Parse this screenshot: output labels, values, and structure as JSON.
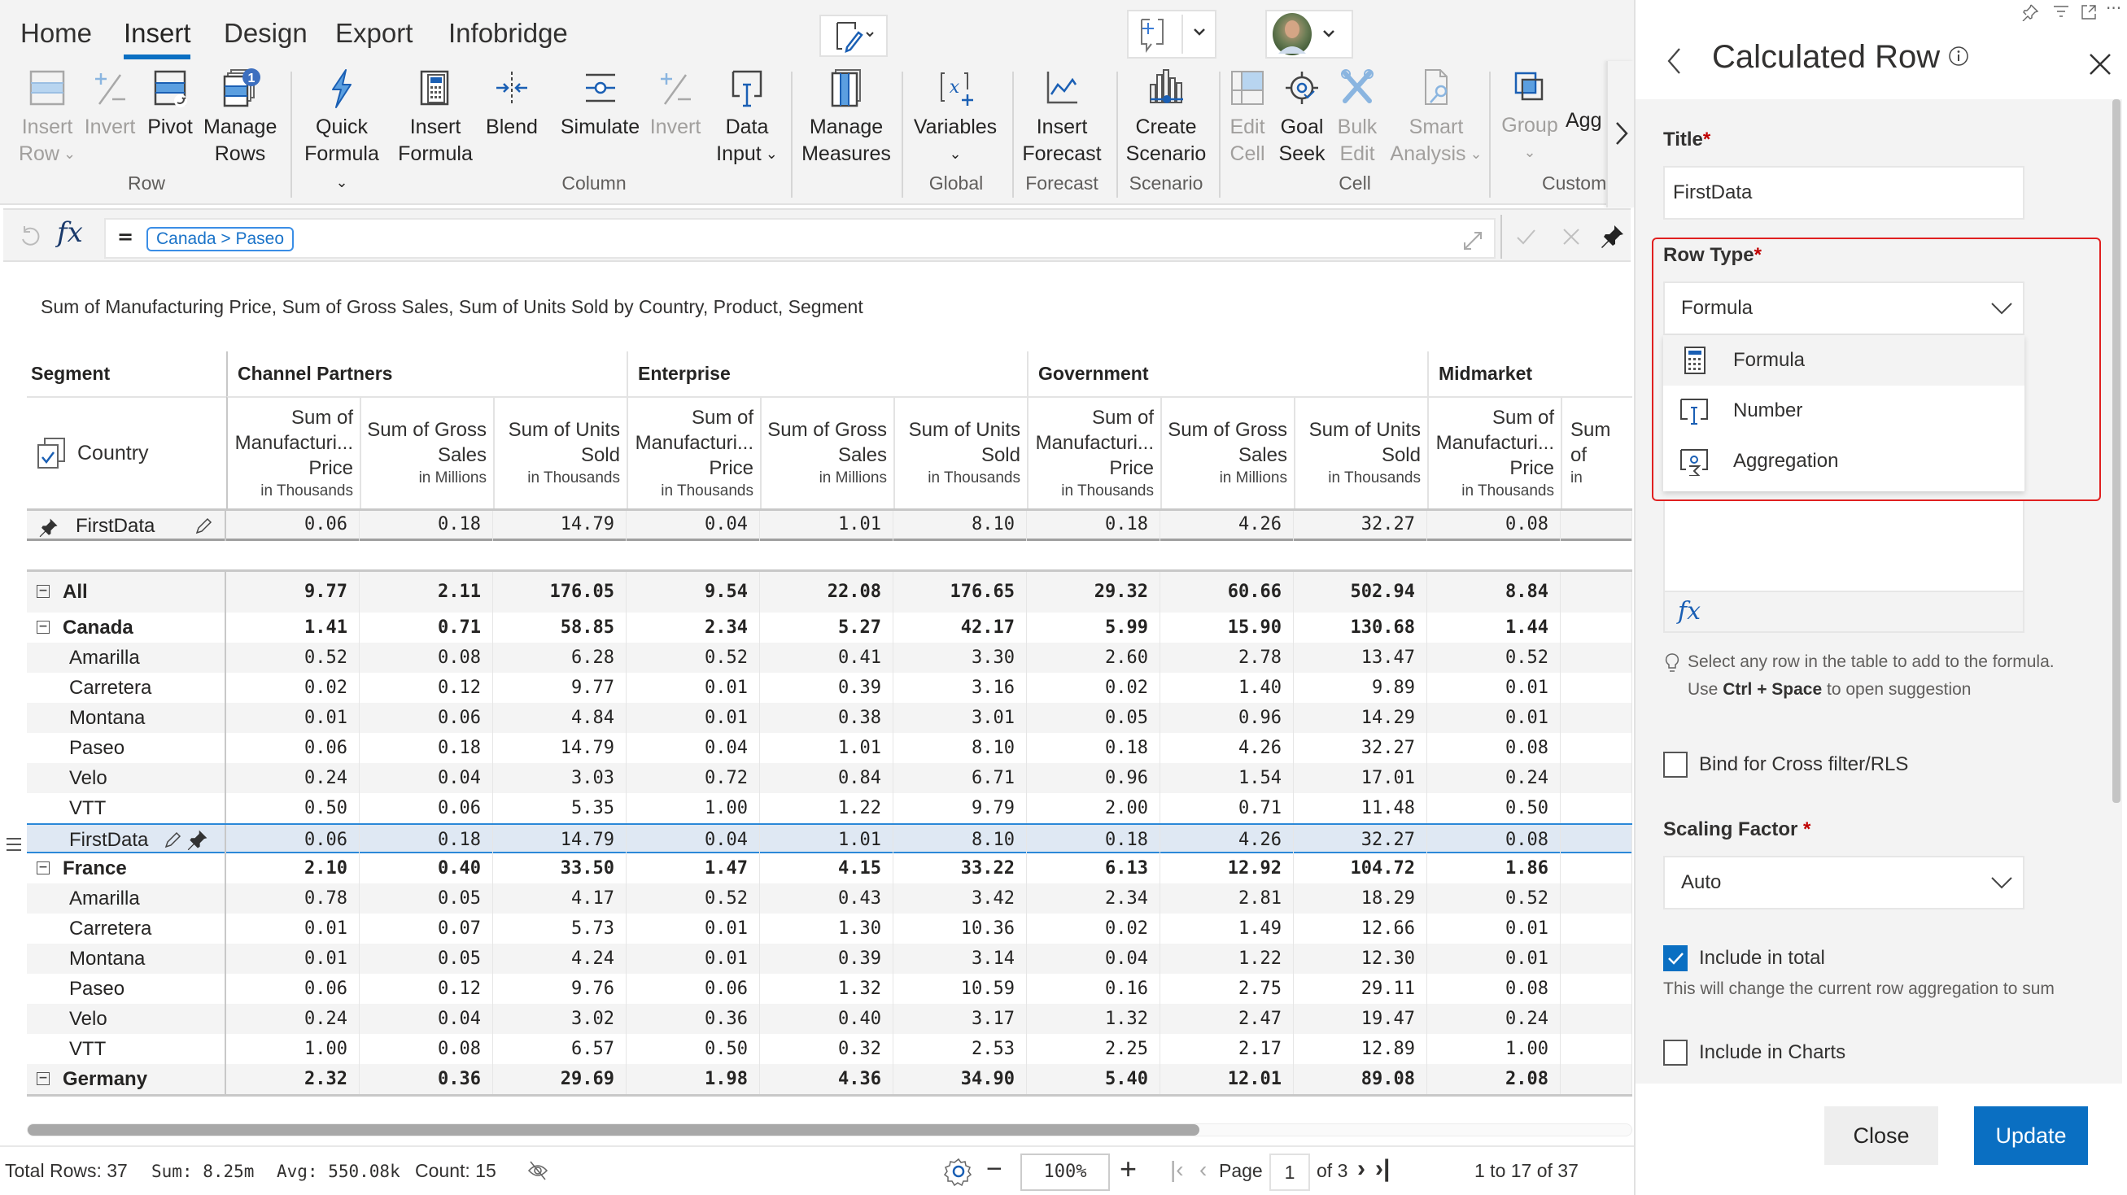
{
  "ribbon": {
    "tabs": [
      {
        "label": "Home",
        "active": false
      },
      {
        "label": "Insert",
        "active": true
      },
      {
        "label": "Design",
        "active": false
      },
      {
        "label": "Export",
        "active": false
      },
      {
        "label": "Infobridge",
        "active": false
      }
    ],
    "buttons": {
      "insert_row": {
        "line1": "Insert",
        "line2": "Row",
        "disabled": true
      },
      "invert_row": {
        "line1": "Invert",
        "disabled": true
      },
      "pivot": {
        "line1": "Pivot"
      },
      "manage_rows": {
        "line1": "Manage",
        "line2": "Rows",
        "badge": "1"
      },
      "quick_formula": {
        "line1": "Quick",
        "line2": "Formula"
      },
      "insert_formula": {
        "line1": "Insert",
        "line2": "Formula"
      },
      "blend": {
        "line1": "Blend"
      },
      "simulate": {
        "line1": "Simulate"
      },
      "invert_col": {
        "line1": "Invert",
        "disabled": true
      },
      "data_input": {
        "line1": "Data",
        "line2": "Input"
      },
      "manage_measures": {
        "line1": "Manage",
        "line2": "Measures"
      },
      "variables": {
        "line1": "Variables"
      },
      "insert_forecast": {
        "line1": "Insert",
        "line2": "Forecast"
      },
      "create_scenario": {
        "line1": "Create",
        "line2": "Scenario"
      },
      "edit_cell": {
        "line1": "Edit",
        "line2": "Cell",
        "disabled": true
      },
      "goal_seek": {
        "line1": "Goal",
        "line2": "Seek"
      },
      "bulk_edit": {
        "line1": "Bulk",
        "line2": "Edit",
        "disabled": true
      },
      "smart_analysis": {
        "line1": "Smart",
        "line2": "Analysis",
        "disabled": true
      },
      "group": {
        "line1": "Group",
        "disabled": true
      },
      "agg": {
        "line1": "Agg"
      }
    },
    "groups": {
      "row": "Row",
      "column": "Column",
      "global": "Global",
      "forecast": "Forecast",
      "scenario": "Scenario",
      "cell": "Cell",
      "custom": "Custom"
    }
  },
  "formula_bar": {
    "equals": "=",
    "chip": "Canada > Paseo"
  },
  "table": {
    "description": "Sum of Manufacturing Price, Sum of Gross Sales, Sum of Units Sold by Country, Product, Segment",
    "segment_header": "Segment",
    "row_header": "Country",
    "segments": [
      "Channel Partners",
      "Enterprise",
      "Government",
      "Midmarket"
    ],
    "measures": [
      {
        "line1": "Sum of",
        "line2": "Manufacturi...",
        "line3": "Price",
        "unit": "in Thousands"
      },
      {
        "line1": "Sum of Gross",
        "line2": "Sales",
        "unit": "in Millions"
      },
      {
        "line1": "Sum of Units",
        "line2": "Sold",
        "unit": "in Thousands"
      }
    ],
    "partial_col": {
      "line1": "Sum of",
      "unit": "in"
    },
    "pinned_row": {
      "label": "FirstData",
      "values": [
        "0.06",
        "0.18",
        "14.79",
        "0.04",
        "1.01",
        "8.10",
        "0.18",
        "4.26",
        "32.27",
        "0.08"
      ]
    },
    "rows": [
      {
        "label": "All",
        "level": 0,
        "bold": true,
        "expander": "−",
        "values": [
          "9.77",
          "2.11",
          "176.05",
          "9.54",
          "22.08",
          "176.65",
          "29.32",
          "60.66",
          "502.94",
          "8.84"
        ]
      },
      {
        "label": "Canada",
        "level": 0,
        "bold": true,
        "expander": "−",
        "values": [
          "1.41",
          "0.71",
          "58.85",
          "2.34",
          "5.27",
          "42.17",
          "5.99",
          "15.90",
          "130.68",
          "1.44"
        ]
      },
      {
        "label": "Amarilla",
        "level": 1,
        "values": [
          "0.52",
          "0.08",
          "6.28",
          "0.52",
          "0.41",
          "3.30",
          "2.60",
          "2.78",
          "13.47",
          "0.52"
        ]
      },
      {
        "label": "Carretera",
        "level": 1,
        "values": [
          "0.02",
          "0.12",
          "9.77",
          "0.01",
          "0.39",
          "3.16",
          "0.02",
          "1.40",
          "9.89",
          "0.01"
        ]
      },
      {
        "label": "Montana",
        "level": 1,
        "values": [
          "0.01",
          "0.06",
          "4.84",
          "0.01",
          "0.38",
          "3.01",
          "0.05",
          "0.96",
          "14.29",
          "0.01"
        ]
      },
      {
        "label": "Paseo",
        "level": 1,
        "values": [
          "0.06",
          "0.18",
          "14.79",
          "0.04",
          "1.01",
          "8.10",
          "0.18",
          "4.26",
          "32.27",
          "0.08"
        ]
      },
      {
        "label": "Velo",
        "level": 1,
        "values": [
          "0.24",
          "0.04",
          "3.03",
          "0.72",
          "0.84",
          "6.71",
          "0.96",
          "1.54",
          "17.01",
          "0.24"
        ]
      },
      {
        "label": "VTT",
        "level": 1,
        "values": [
          "0.50",
          "0.06",
          "5.35",
          "1.00",
          "1.22",
          "9.79",
          "2.00",
          "0.71",
          "11.48",
          "0.50"
        ]
      },
      {
        "label": "FirstData",
        "level": 1,
        "selected": true,
        "calculated": true,
        "values": [
          "0.06",
          "0.18",
          "14.79",
          "0.04",
          "1.01",
          "8.10",
          "0.18",
          "4.26",
          "32.27",
          "0.08"
        ]
      },
      {
        "label": "France",
        "level": 0,
        "bold": true,
        "expander": "−",
        "values": [
          "2.10",
          "0.40",
          "33.50",
          "1.47",
          "4.15",
          "33.22",
          "6.13",
          "12.92",
          "104.72",
          "1.86"
        ]
      },
      {
        "label": "Amarilla",
        "level": 1,
        "values": [
          "0.78",
          "0.05",
          "4.17",
          "0.52",
          "0.43",
          "3.42",
          "2.34",
          "2.81",
          "18.29",
          "0.52"
        ]
      },
      {
        "label": "Carretera",
        "level": 1,
        "values": [
          "0.01",
          "0.07",
          "5.73",
          "0.01",
          "1.30",
          "10.36",
          "0.02",
          "1.49",
          "12.66",
          "0.01"
        ]
      },
      {
        "label": "Montana",
        "level": 1,
        "values": [
          "0.01",
          "0.05",
          "4.24",
          "0.01",
          "0.39",
          "3.14",
          "0.04",
          "1.22",
          "12.30",
          "0.01"
        ]
      },
      {
        "label": "Paseo",
        "level": 1,
        "values": [
          "0.06",
          "0.12",
          "9.76",
          "0.06",
          "1.32",
          "10.59",
          "0.16",
          "2.75",
          "29.11",
          "0.08"
        ]
      },
      {
        "label": "Velo",
        "level": 1,
        "values": [
          "0.24",
          "0.04",
          "3.02",
          "0.36",
          "0.40",
          "3.17",
          "1.32",
          "2.47",
          "19.47",
          "0.24"
        ]
      },
      {
        "label": "VTT",
        "level": 1,
        "values": [
          "1.00",
          "0.08",
          "6.57",
          "0.50",
          "0.32",
          "2.53",
          "2.25",
          "2.17",
          "12.89",
          "1.00"
        ]
      },
      {
        "label": "Germany",
        "level": 0,
        "bold": true,
        "expander": "−",
        "values": [
          "2.32",
          "0.36",
          "29.69",
          "1.98",
          "4.36",
          "34.90",
          "5.40",
          "12.01",
          "89.08",
          "2.08"
        ]
      }
    ]
  },
  "status_bar": {
    "total_rows": "Total Rows: 37",
    "sum": "Sum: 8.25m",
    "avg": "Avg: 550.08k",
    "count": "Count: 15",
    "zoom": "100%",
    "page_label": "Page",
    "page_value": "1",
    "page_of": "of 3",
    "range": "1 to 17 of 37",
    "horizontal_scroll_fraction": 0.73
  },
  "panel": {
    "title": "Calculated Row",
    "title_label": "Title",
    "title_value": "FirstData",
    "row_type_label": "Row Type",
    "row_type_value": "Formula",
    "row_type_options": [
      "Formula",
      "Number",
      "Aggregation"
    ],
    "hint_line1": "Select any row in the table to add to the formula.",
    "hint_use": "Use ",
    "hint_keys": "Ctrl + Space",
    "hint_rest": " to open suggestion",
    "bind_label": "Bind for Cross filter/RLS",
    "bind_checked": false,
    "scaling_label": "Scaling Factor",
    "scaling_value": "Auto",
    "include_total_label": "Include in total",
    "include_total_checked": true,
    "include_total_note": "This will change the current row aggregation to sum",
    "include_charts_label": "Include in Charts",
    "include_charts_checked": false,
    "close_label": "Close",
    "update_label": "Update",
    "required_mark": "*"
  },
  "colors": {
    "accent": "#0A6FC2",
    "required": "#C00000",
    "highlight_border": "#E02020",
    "selected_row": "#DFE8F3"
  }
}
